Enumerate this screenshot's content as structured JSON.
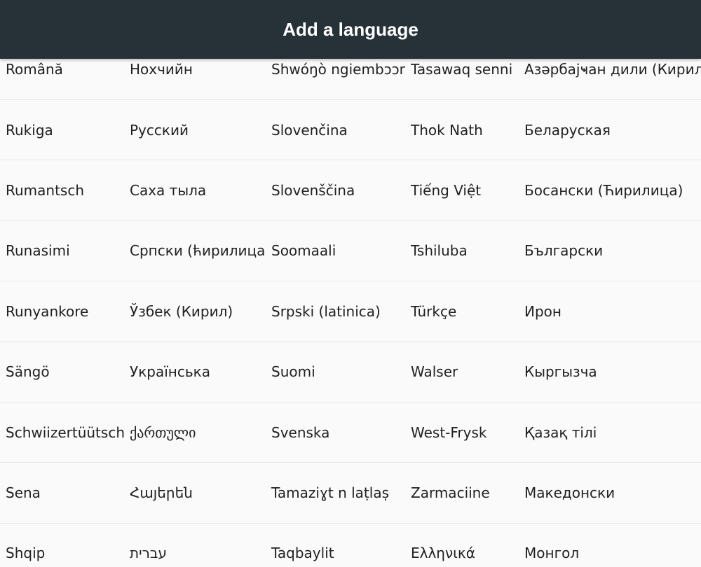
{
  "header": {
    "title": "Add a language"
  },
  "rows": [
    [
      "Română",
      "Нохчийн",
      "Shwóŋò ngiembɔɔn",
      "Tasawaq senni",
      "Азәрбајҹан дили (Кирил)"
    ],
    [
      "Rukiga",
      "Русский",
      "Slovenčina",
      "Thok Nath",
      "Беларуская"
    ],
    [
      "Rumantsch",
      "Саха тыла",
      "Slovenščina",
      "Tiếng Việt",
      "Босански (Ћирилица)"
    ],
    [
      "Runasimi",
      "Српски (ћирилица)",
      "Soomaali",
      "Tshiluba",
      "Български"
    ],
    [
      "Runyankore",
      "Ўзбек (Кирил)",
      "Srpski (latinica)",
      "Türkçe",
      "Ирон"
    ],
    [
      "Sängö",
      "Українська",
      "Suomi",
      "Walser",
      "Кыргызча"
    ],
    [
      "Schwiizertüütsch",
      "ქართული",
      "Svenska",
      "West-Frysk",
      "Қазақ тілі"
    ],
    [
      "Sena",
      "Հայերեն",
      "Tamaziɣt n laṭlaṣ",
      "Zarmaciine",
      "Македонски"
    ],
    [
      "Shqip",
      "עברית",
      "Taqbaylit",
      "Ελληνικά",
      "Монгол"
    ]
  ]
}
